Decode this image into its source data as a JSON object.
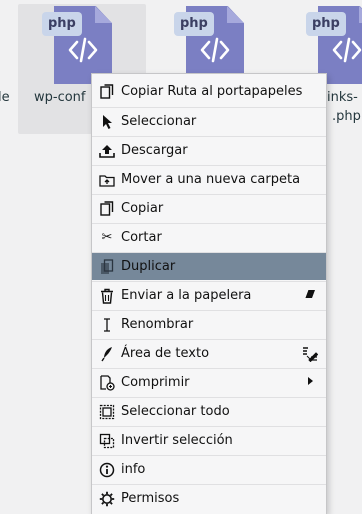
{
  "files": [
    {
      "badge": "php",
      "name": "le",
      "selected": false
    },
    {
      "badge": "php",
      "name": "wp-conf",
      "selected": true
    },
    {
      "badge": "php",
      "name": "",
      "selected": false
    },
    {
      "badge": "php",
      "name_line1": "inks-",
      "name_line2": ".php",
      "selected": false
    }
  ],
  "menu": {
    "items": [
      {
        "label": "Copiar Ruta al portapapeles",
        "icon": "copy-icon"
      },
      {
        "label": "Seleccionar",
        "icon": "cursor-icon"
      },
      {
        "label": "Descargar",
        "icon": "download-icon"
      },
      {
        "label": "Mover a una nueva carpeta",
        "icon": "move-folder-icon"
      },
      {
        "label": "Copiar",
        "icon": "copy-icon"
      },
      {
        "label": "Cortar",
        "icon": "scissors-icon"
      },
      {
        "label": "Duplicar",
        "icon": "duplicate-icon",
        "active": true
      },
      {
        "label": "Enviar a la papelera",
        "icon": "trash-icon",
        "right_icon": "eraser-icon"
      },
      {
        "label": "Renombrar",
        "icon": "text-cursor-icon"
      },
      {
        "label": "Área de texto",
        "icon": "feather-icon",
        "right_icon": "text-edit-icon"
      },
      {
        "label": "Comprimir",
        "icon": "compress-icon",
        "right_icon": "chevron-right-icon"
      },
      {
        "label": "Seleccionar todo",
        "icon": "select-all-icon"
      },
      {
        "label": "Invertir selección",
        "icon": "invert-selection-icon"
      },
      {
        "label": "info",
        "icon": "info-icon"
      },
      {
        "label": "Permisos",
        "icon": "gear-icon"
      }
    ]
  },
  "colors": {
    "background": "#f1f1f2",
    "file_icon": "#7b7fc3",
    "badge": "#c9d5ea",
    "active_item": "#76889a",
    "filename_text": "#24373d"
  }
}
